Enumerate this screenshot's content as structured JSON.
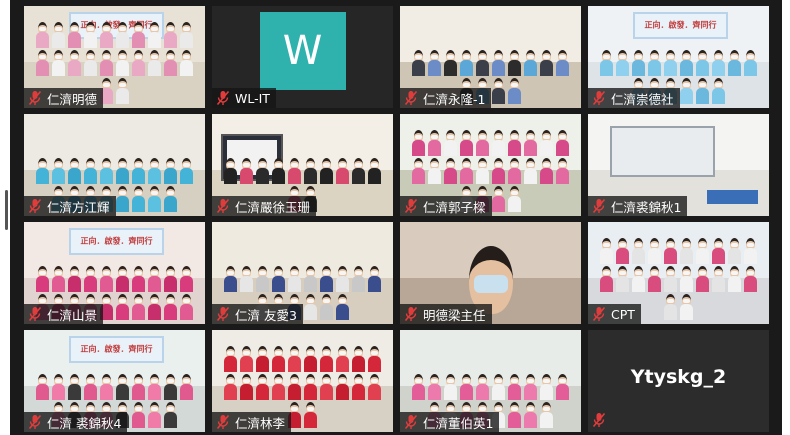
{
  "participants": [
    {
      "name": "仁濟明德",
      "muted": true,
      "wall": "#e8e2d6",
      "floor": "#d9d1c2",
      "shirts": [
        "#e9a8c4",
        "#eaeaea",
        "#e38fb3",
        "#f2f2f2"
      ],
      "banner": "正向．啟發．齊同行",
      "count": 22
    },
    {
      "name": "WL-IT",
      "muted": true,
      "avatar_letter": "W",
      "avatar_color": "#2fb2ad"
    },
    {
      "name": "仁濟永隆-1",
      "muted": true,
      "wall": "#f1ede4",
      "floor": "#cfc5b4",
      "shirts": [
        "#3a3f4a",
        "#6b8cc6",
        "#2c2c2c",
        "#5aa7d8"
      ],
      "count": 14
    },
    {
      "name": "仁濟崇德社",
      "muted": true,
      "wall": "#eef2f5",
      "floor": "#dde3e6",
      "shirts": [
        "#7cc7e8",
        "#8fd0ee",
        "#6bb8de"
      ],
      "banner": "正向．啟發．齊同行",
      "count": 16
    },
    {
      "name": "仁濟方江輝",
      "muted": true,
      "wall": "#eceae3",
      "floor": "#d6d0c3",
      "shirts": [
        "#43b3d8",
        "#5cc0e0",
        "#3aa6cc"
      ],
      "count": 18
    },
    {
      "name": "仁濟嚴徐玉珊",
      "muted": true,
      "active": true,
      "wall": "#f3efe6",
      "floor": "#dcd4c3",
      "shirts": [
        "#222222",
        "#d74a6e",
        "#2b2b2b"
      ],
      "count": 12
    },
    {
      "name": "仁濟郭子樑",
      "muted": true,
      "wall": "#eef0ea",
      "floor": "#c9cbb9",
      "shirts": [
        "#d64a8a",
        "#e36aa0",
        "#f2f2f2"
      ],
      "count": 24
    },
    {
      "name": "仁濟裘錦秋1",
      "muted": true,
      "wall": "#f4f4f2",
      "floor": "#e3e1dc",
      "shirts": [
        "#4aa3d6"
      ],
      "count": 0
    },
    {
      "name": "仁濟山景",
      "muted": true,
      "wall": "#f2e9e4",
      "floor": "#e1d3cf",
      "shirts": [
        "#d83c7c",
        "#e25a92",
        "#c72f6c"
      ],
      "banner": "正向．啟發．齊同行",
      "count": 20
    },
    {
      "name": "仁濟 友愛3",
      "muted": true,
      "wall": "#efeae0",
      "floor": "#d7cec0",
      "shirts": [
        "#3a4d8c",
        "#e6e6e6",
        "#c8c8c8"
      ],
      "count": 16
    },
    {
      "name": "明德梁主任",
      "muted": true,
      "wall": "#d9cbbd",
      "floor": "#b8a796",
      "teacher": true
    },
    {
      "name": "CPT",
      "muted": true,
      "wall": "#e9eef2",
      "floor": "#d7d9dc",
      "shirts": [
        "#f2f2f2",
        "#d84d7e",
        "#e4e4e4"
      ],
      "count": 22
    },
    {
      "name": "仁濟 裘錦秋4",
      "muted": true,
      "wall": "#e9f0ee",
      "floor": "#d2d9d6",
      "shirts": [
        "#e05a90",
        "#f07aa8",
        "#3a3a3a"
      ],
      "banner": "正向．啟發．齊同行",
      "count": 18
    },
    {
      "name": "仁濟林李",
      "muted": true,
      "wall": "#efece6",
      "floor": "#d7d0c4",
      "shirts": [
        "#d4283a",
        "#e04050",
        "#c41e30"
      ],
      "count": 22
    },
    {
      "name": "仁濟董伯英1",
      "muted": true,
      "wall": "#e8ece9",
      "floor": "#cfd3cc",
      "shirts": [
        "#e35d99",
        "#ec7aad",
        "#f2f2f2"
      ],
      "count": 18
    },
    {
      "name": "Ytysk g_2",
      "display_name": "Ytyskg_2",
      "muted": true,
      "name_only": true
    }
  ]
}
